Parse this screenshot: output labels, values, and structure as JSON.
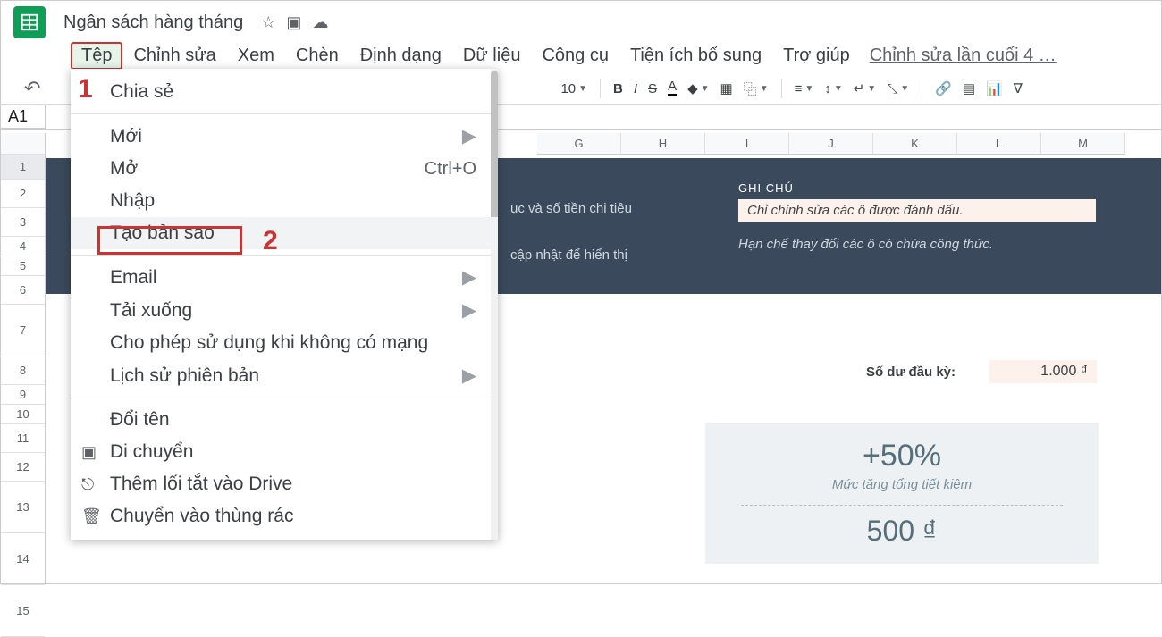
{
  "doc": {
    "title": "Ngân sách hàng tháng"
  },
  "menubar": {
    "file": "Tệp",
    "edit": "Chỉnh sửa",
    "view": "Xem",
    "insert": "Chèn",
    "format": "Định dạng",
    "data": "Dữ liệu",
    "tools": "Công cụ",
    "addons": "Tiện ích bổ sung",
    "help": "Trợ giúp",
    "lastedit": "Chỉnh sửa lần cuối 4 …"
  },
  "toolbar": {
    "fontsize": "10",
    "bold": "B",
    "italic": "I",
    "strike": "S",
    "textA": "A"
  },
  "cellref": "A1",
  "columns": [
    "G",
    "H",
    "I",
    "J",
    "K",
    "L",
    "M"
  ],
  "rows": [
    "1",
    "2",
    "3",
    "4",
    "5",
    "6",
    "7",
    "8",
    "9",
    "10",
    "11",
    "12",
    "13",
    "14",
    "15"
  ],
  "dropdown": {
    "share": "Chia sẻ",
    "new": "Mới",
    "open": "Mở",
    "open_sc": "Ctrl+O",
    "import": "Nhập",
    "makecopy": "Tạo bản sao",
    "email": "Email",
    "download": "Tải xuống",
    "offline": "Cho phép sử dụng khi không có mạng",
    "history": "Lịch sử phiên bản",
    "rename": "Đổi tên",
    "move": "Di chuyển",
    "shortcut": "Thêm lối tắt vào Drive",
    "trash": "Chuyển vào thùng rác"
  },
  "callouts": {
    "one": "1",
    "two": "2"
  },
  "sheet": {
    "hint1": "ục và số tiền chi tiêu",
    "hint2": "cập nhật để hiển thị",
    "notes_hdr": "GHI CHÚ",
    "editable_note": "Chỉ chỉnh sửa các ô được đánh dấu.",
    "formula_note": "Hạn chế thay đổi các ô có chứa công thức.",
    "balance_label": "Số dư đầu kỳ:",
    "balance_value": "1.000 ₫",
    "card_pct": "+50%",
    "card_sub": "Mức tăng tổng tiết kiệm",
    "card_amt": "500 ₫"
  }
}
